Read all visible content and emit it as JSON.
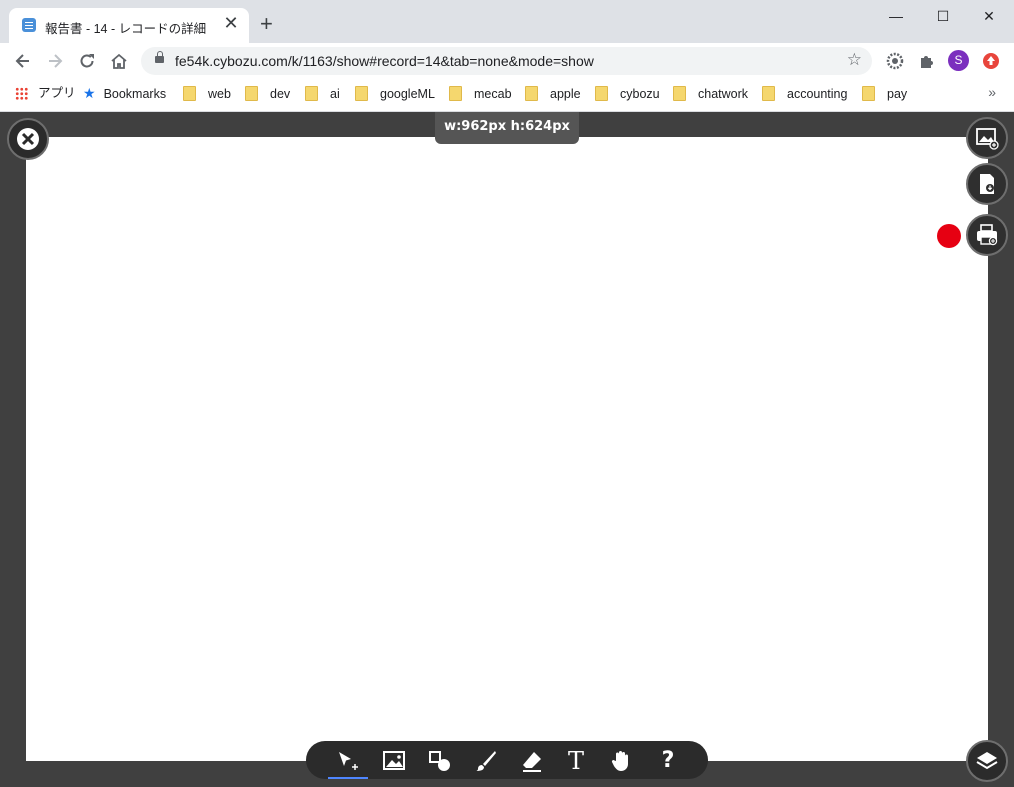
{
  "browser": {
    "tab": {
      "title": "報告書 - 14 - レコードの詳細",
      "close_glyph": "✕"
    },
    "new_tab_glyph": "+",
    "window_controls": {
      "minimize": "—",
      "maximize": "☐",
      "close": "✕"
    },
    "address": {
      "url": "fe54k.cybozu.com/k/1163/show#record=14&tab=none&mode=show"
    },
    "avatar_letter": "S",
    "bookmarks": [
      {
        "label": "アプリ",
        "icon": "apps-grid-icon"
      },
      {
        "label": "Bookmarks",
        "icon": "star-icon"
      },
      {
        "label": "web",
        "icon": "folder-icon"
      },
      {
        "label": "dev",
        "icon": "folder-icon"
      },
      {
        "label": "ai",
        "icon": "folder-icon"
      },
      {
        "label": "googleML",
        "icon": "folder-icon"
      },
      {
        "label": "mecab",
        "icon": "folder-icon"
      },
      {
        "label": "apple",
        "icon": "folder-icon"
      },
      {
        "label": "cybozu",
        "icon": "folder-icon"
      },
      {
        "label": "chatwork",
        "icon": "folder-icon"
      },
      {
        "label": "accounting",
        "icon": "folder-icon"
      },
      {
        "label": "pay",
        "icon": "folder-icon"
      }
    ],
    "overflow_glyph": "»"
  },
  "editor": {
    "canvas_size": "w:962px  h:624px",
    "colors": {
      "background": "#404040",
      "canvas": "#ffffff",
      "record_dot": "#e60012",
      "active_tool": "#4f86ff"
    },
    "side_buttons": [
      "close-icon",
      "image-add-icon",
      "document-download-icon",
      "print-icon",
      "layers-icon"
    ],
    "tools": [
      "select-tool",
      "image-tool",
      "shape-tool",
      "brush-tool",
      "eraser-tool",
      "text-tool",
      "hand-tool",
      "help"
    ],
    "active_tool": "select-tool",
    "text_tool_glyph": "T",
    "help_glyph": "?"
  }
}
